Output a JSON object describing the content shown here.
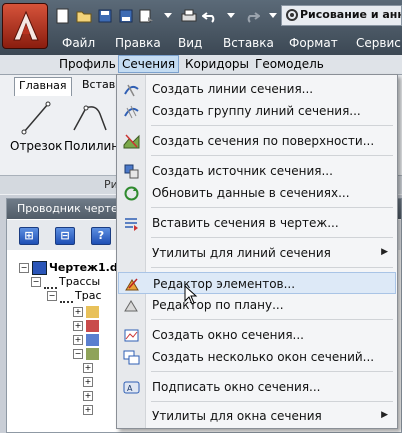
{
  "workspace": {
    "label": "Рисование и аннотации"
  },
  "menubar": {
    "items": [
      "Файл",
      "Правка",
      "Вид",
      "Вставка",
      "Формат",
      "Сервис"
    ]
  },
  "menubar2": {
    "items": [
      "Профиль",
      "Сечения",
      "Коридоры",
      "Геомодель"
    ],
    "active": "Сечения"
  },
  "ribbon": {
    "tabs": [
      "Главная",
      "Встав"
    ],
    "tools": [
      "Отрезок",
      "Полилин"
    ],
    "panel_label": "Ри"
  },
  "explorer": {
    "title": "Проводник черте",
    "tree": {
      "root": "Чертеж1.d",
      "child": "Трассы",
      "grandchild": "Трас"
    }
  },
  "menu": {
    "items": [
      {
        "label": "Создать линии сечения...",
        "icon": "section-lines-icon"
      },
      {
        "label": "Создать группу линий сечения...",
        "icon": "section-group-icon"
      },
      {
        "label": "Создать сечения по поверхности...",
        "icon": "surface-section-icon"
      },
      {
        "label": "Создать источник сечения...",
        "icon": "section-source-icon"
      },
      {
        "label": "Обновить данные в сечениях...",
        "icon": "update-section-icon"
      },
      {
        "label": "Вставить сечения в чертеж...",
        "icon": "insert-section-icon"
      },
      {
        "label": "Утилиты для линий сечения",
        "icon": "",
        "submenu": true
      },
      {
        "label": "Редактор элементов...",
        "icon": "element-editor-icon"
      },
      {
        "label": "Редактор по плану...",
        "icon": "plan-editor-icon"
      },
      {
        "label": "Создать окно сечения...",
        "icon": "section-view-icon"
      },
      {
        "label": "Создать несколько окон сечений...",
        "icon": "multiple-section-views-icon"
      },
      {
        "label": "Подписать окно сечения...",
        "icon": "annotate-section-view-icon"
      },
      {
        "label": "Утилиты для окна сечения",
        "icon": "",
        "submenu": true
      }
    ],
    "highlighted": "Редактор элементов..."
  },
  "colors": {
    "titlebar": "#4a5866",
    "menu_highlight": "#dde9f7",
    "app_button": "#c0412a"
  }
}
